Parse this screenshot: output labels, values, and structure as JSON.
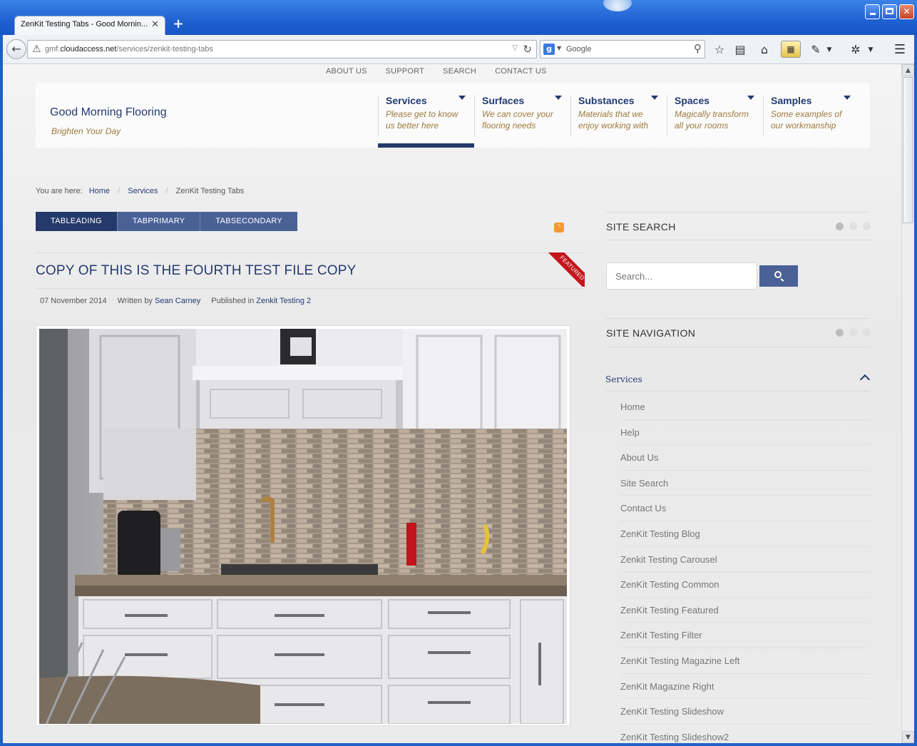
{
  "browser": {
    "tab_title": "ZenKit Testing Tabs - Good Mornin...",
    "tab_close": "✕",
    "new_tab": "+",
    "url_prefix": "gmf.",
    "url_domain": "cloudaccess.net",
    "url_path": "/services/zenkit-testing-tabs",
    "search_engine_placeholder": "Google",
    "icons": [
      "back-arrow-icon",
      "warning-icon",
      "reload-icon",
      "google-icon",
      "magnifier-icon",
      "star-icon",
      "reader-icon",
      "home-icon",
      "extension-icon",
      "pipette-icon",
      "bug-icon",
      "menu-icon"
    ]
  },
  "site": {
    "top_menu": [
      "ABOUT US",
      "SUPPORT",
      "SEARCH",
      "CONTACT US"
    ],
    "title": "Good Morning Flooring",
    "tagline": "Brighten Your Day",
    "main_nav": [
      {
        "title": "Services",
        "desc": "Please get to know us better here"
      },
      {
        "title": "Surfaces",
        "desc": "We can cover your flooring needs"
      },
      {
        "title": "Substances",
        "desc": "Materials that we enjoy working with"
      },
      {
        "title": "Spaces",
        "desc": "Magically transform all your rooms"
      },
      {
        "title": "Samples",
        "desc": "Some examples of our workmanship"
      }
    ],
    "active_nav": "Services",
    "accent_color": "#253a6b",
    "gold_color": "#9c7a3c"
  },
  "breadcrumb": {
    "prefix": "You are here:",
    "items": [
      "Home",
      "Services",
      "ZenKit Testing Tabs"
    ]
  },
  "tabs": [
    "TABLEADING",
    "TABPRIMARY",
    "TABSECONDARY"
  ],
  "article": {
    "title": "COPY OF THIS IS THE FOURTH TEST FILE COPY",
    "featured_label": "FEATURED",
    "date": "07 November 2014",
    "written_by_label": "Written by",
    "author": "Sean Carney",
    "published_in_label": "Published in",
    "category": "Zenkit Testing 2",
    "image_subject": "kitchen with white cabinets and mosaic tile backsplash"
  },
  "sidebar": {
    "search_title": "SITE SEARCH",
    "search_placeholder": "Search...",
    "nav_title": "SITE NAVIGATION",
    "nav_parent": "Services",
    "nav_items": [
      "Home",
      "Help",
      "About Us",
      "Site Search",
      "Contact Us",
      "ZenKit Testing Blog",
      "Zenkit Testing Carousel",
      "ZenKit Testing Common",
      "ZenKit Testing Featured",
      "ZenKit Testing Filter",
      "ZenKit Testing Magazine Left",
      "ZenKit Magazine Right",
      "ZenKit Testing Slideshow",
      "ZenKit Testing Slideshow2"
    ]
  }
}
